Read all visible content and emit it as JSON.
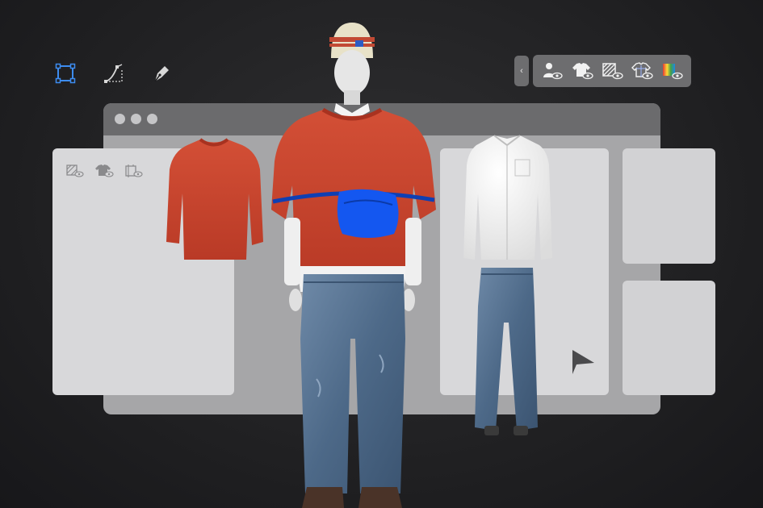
{
  "left_tools": [
    {
      "name": "bounding-box-tool",
      "icon": "bounding-box-icon",
      "active": true
    },
    {
      "name": "curve-tool",
      "icon": "curve-path-icon",
      "active": false
    },
    {
      "name": "pen-tool",
      "icon": "pen-nib-icon",
      "active": false
    }
  ],
  "view_toolbar": {
    "collapse_icon": "‹",
    "buttons": [
      {
        "name": "avatar-visibility",
        "icon": "avatar-eye-icon"
      },
      {
        "name": "garment-visibility",
        "icon": "garment-eye-icon"
      },
      {
        "name": "pattern-visibility",
        "icon": "pattern-eye-icon"
      },
      {
        "name": "garment-wireframe-visibility",
        "icon": "garment-outline-eye-icon"
      },
      {
        "name": "color-map-visibility",
        "icon": "colormap-eye-icon"
      }
    ]
  },
  "colors": {
    "accent": "#3d8cf0",
    "toolbar_bg": "#6d6d6f",
    "window_bg": "#a6a6a8",
    "titlebar_bg": "#6b6b6d",
    "panel_bg": "#d8d8da",
    "sweater": "#c9452f",
    "bag": "#1457f0",
    "jeans": "#4f6d8f"
  }
}
